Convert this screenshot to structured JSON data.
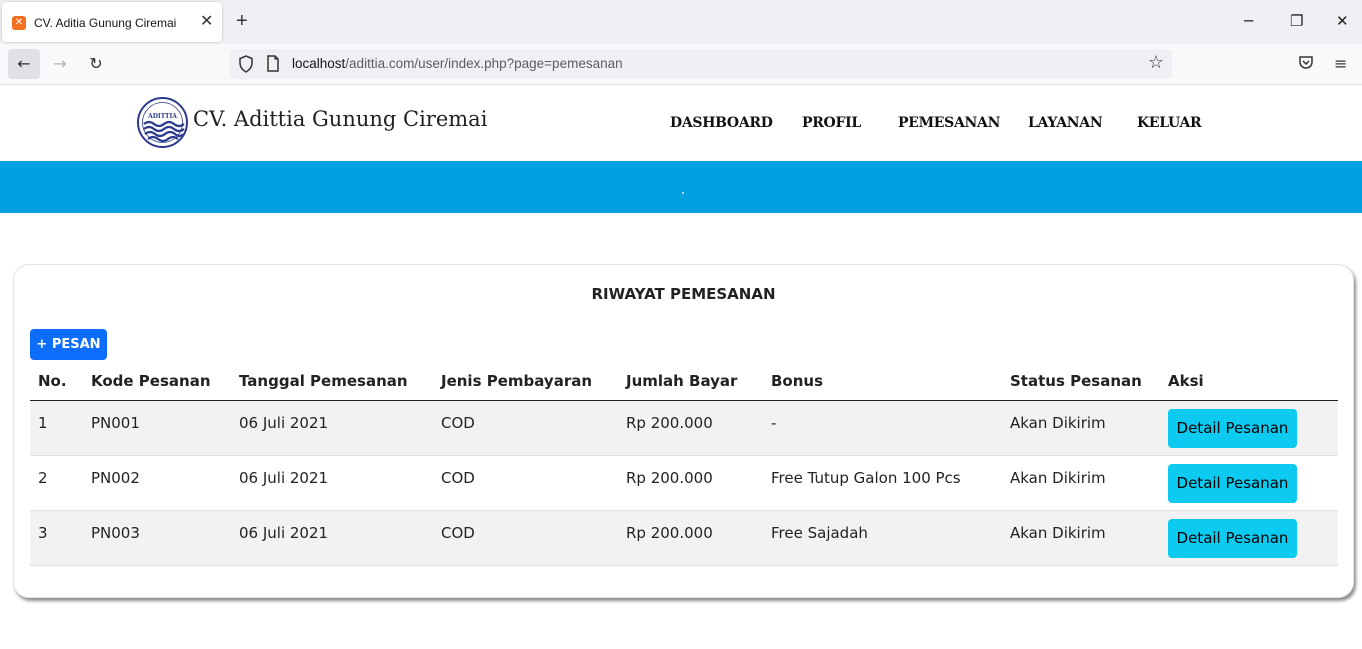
{
  "browser": {
    "tab_title": "CV. Aditia Gunung Ciremai",
    "url_host": "localhost",
    "url_path": "/adittia.com/user/index.php?page=pemesanan"
  },
  "site": {
    "brand": "CV. Adittia Gunung Ciremai",
    "logo_text": "ADITTIA",
    "menu": [
      "DASHBOARD",
      "PROFIL",
      "PEMESANAN",
      "LAYANAN",
      "KELUAR"
    ]
  },
  "card": {
    "title": "RIWAYAT PEMESANAN",
    "add_button": "+ PESAN",
    "columns": [
      "No.",
      "Kode Pesanan",
      "Tanggal Pemesanan",
      "Jenis Pembayaran",
      "Jumlah Bayar",
      "Bonus",
      "Status Pesanan",
      "Aksi"
    ],
    "rows": [
      {
        "no": "1",
        "kode": "PN001",
        "tanggal": "06 Juli 2021",
        "jenis": "COD",
        "jumlah": "Rp 200.000",
        "bonus": "-",
        "status": "Akan Dikirim",
        "aksi": "Detail Pesanan"
      },
      {
        "no": "2",
        "kode": "PN002",
        "tanggal": "06 Juli 2021",
        "jenis": "COD",
        "jumlah": "Rp 200.000",
        "bonus": "Free Tutup Galon 100 Pcs",
        "status": "Akan Dikirim",
        "aksi": "Detail Pesanan"
      },
      {
        "no": "3",
        "kode": "PN003",
        "tanggal": "06 Juli 2021",
        "jenis": "COD",
        "jumlah": "Rp 200.000",
        "bonus": "Free Sajadah",
        "status": "Akan Dikirim",
        "aksi": "Detail Pesanan"
      }
    ]
  },
  "colors": {
    "banner": "#00a0e0",
    "primary": "#0d6efd",
    "info": "#0dcaf0"
  }
}
